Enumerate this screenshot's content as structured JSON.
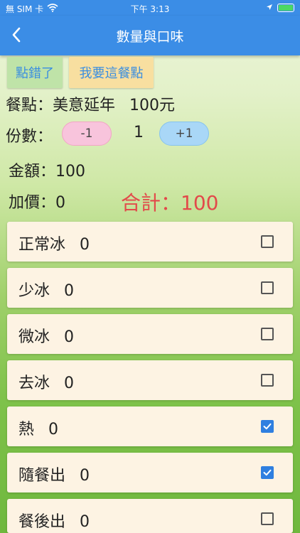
{
  "status": {
    "carrier": "無 SIM 卡",
    "time": "下午 3:13"
  },
  "nav": {
    "title": "數量與口味"
  },
  "buttons": {
    "wrong": "點錯了",
    "order": "我要這餐點"
  },
  "meal": {
    "label": "餐點：",
    "name": "美意延年",
    "price": "100元"
  },
  "qty": {
    "label": "份數：",
    "minus": "-1",
    "value": "1",
    "plus": "+1"
  },
  "amount": {
    "label": "金額：",
    "value": "100"
  },
  "surcharge": {
    "label": "加價：",
    "value": "0"
  },
  "total": {
    "label": "合計：",
    "value": "100"
  },
  "options": [
    {
      "name": "正常冰",
      "count": "0",
      "checked": false
    },
    {
      "name": "少冰",
      "count": "0",
      "checked": false
    },
    {
      "name": "微冰",
      "count": "0",
      "checked": false
    },
    {
      "name": "去冰",
      "count": "0",
      "checked": false
    },
    {
      "name": "熱",
      "count": "0",
      "checked": true
    },
    {
      "name": "隨餐出",
      "count": "0",
      "checked": true
    },
    {
      "name": "餐後出",
      "count": "0",
      "checked": false
    }
  ],
  "colors": {
    "nav": "#3b8de6",
    "checkbox": "#2f7fe0",
    "total": "#e24a4a",
    "card": "#fdf3e3"
  }
}
